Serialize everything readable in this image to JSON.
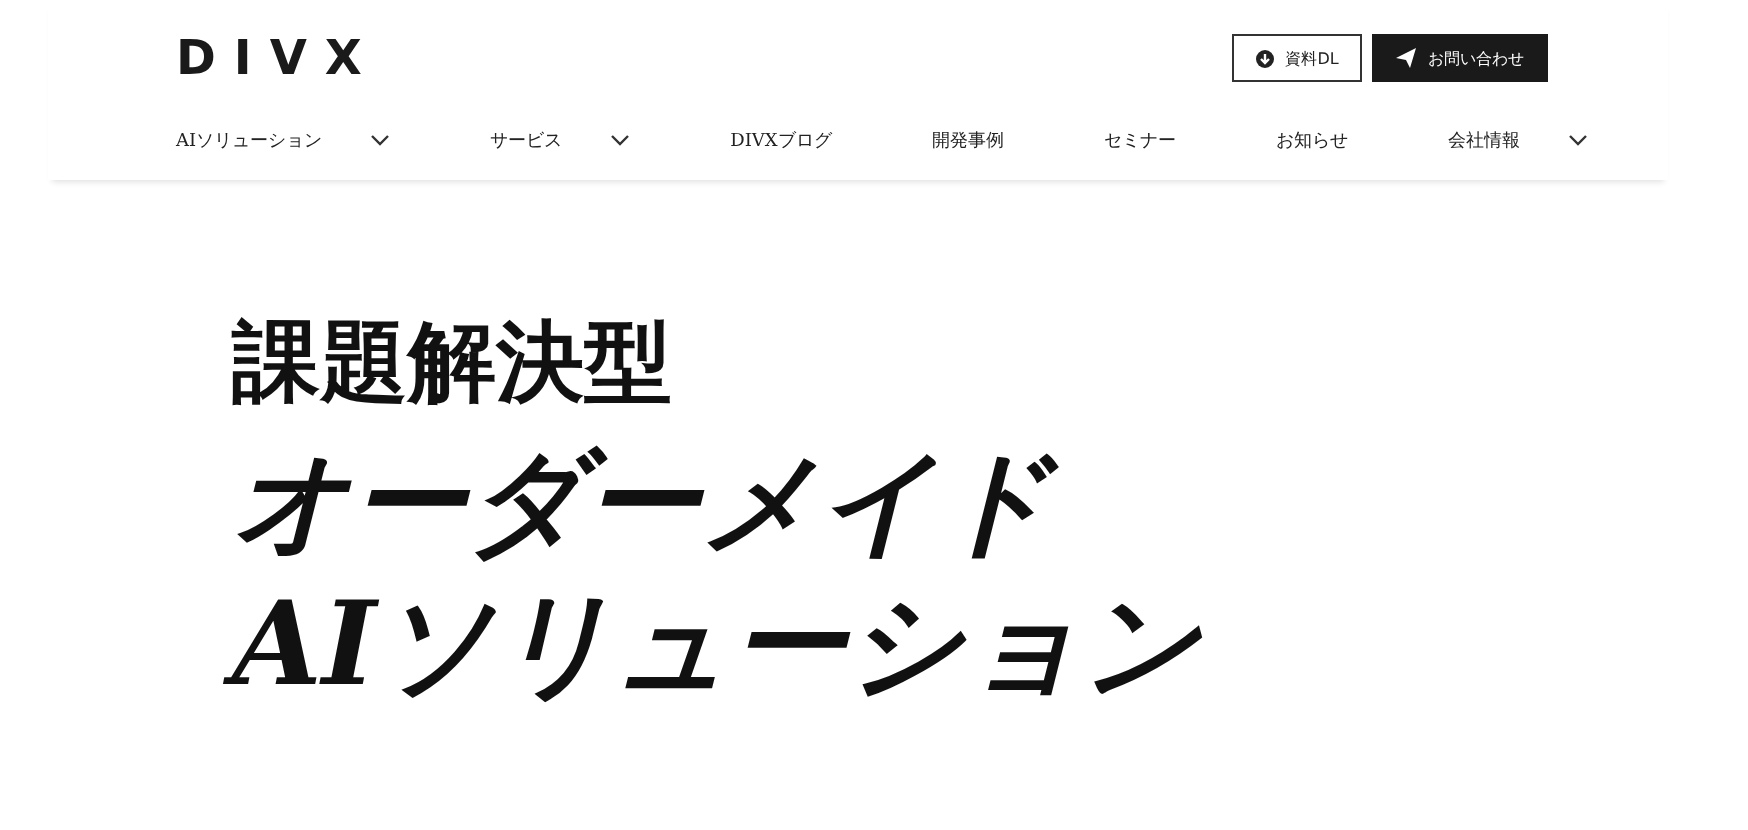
{
  "logo": "DIVX",
  "header_buttons": [
    {
      "kind": "outline",
      "label": "資料DL"
    },
    {
      "kind": "filled",
      "label": "お問い合わせ"
    }
  ],
  "nav": [
    {
      "label": "AIソリューション",
      "dropdown": true
    },
    {
      "label": "サービス",
      "dropdown": true
    },
    {
      "label": "DIVXブログ",
      "dropdown": false
    },
    {
      "label": "開発事例",
      "dropdown": false
    },
    {
      "label": "セミナー",
      "dropdown": false
    },
    {
      "label": "お知らせ",
      "dropdown": false
    },
    {
      "label": "会社情報",
      "dropdown": true
    }
  ],
  "hero": {
    "lines": [
      "課題解決型",
      "オーダーメイド",
      "AIソリューション"
    ]
  }
}
